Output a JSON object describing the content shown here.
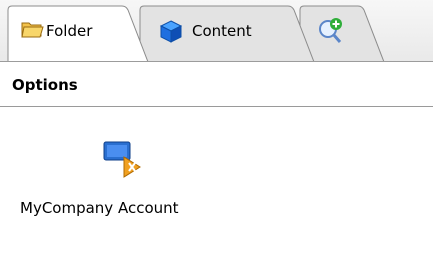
{
  "tabs": [
    {
      "label": "Folder",
      "icon": "folder-icon",
      "active": true
    },
    {
      "label": "Content",
      "icon": "cube-icon",
      "active": false
    },
    {
      "label": "",
      "icon": "search-add-icon",
      "active": false
    }
  ],
  "panel": {
    "title": "Options"
  },
  "items": [
    {
      "label": "MyCompany Account",
      "icon": "company-account-icon"
    }
  ],
  "colors": {
    "accent_orange": "#f0a020",
    "accent_blue": "#2a6fd0",
    "border": "#8c8c8c"
  }
}
